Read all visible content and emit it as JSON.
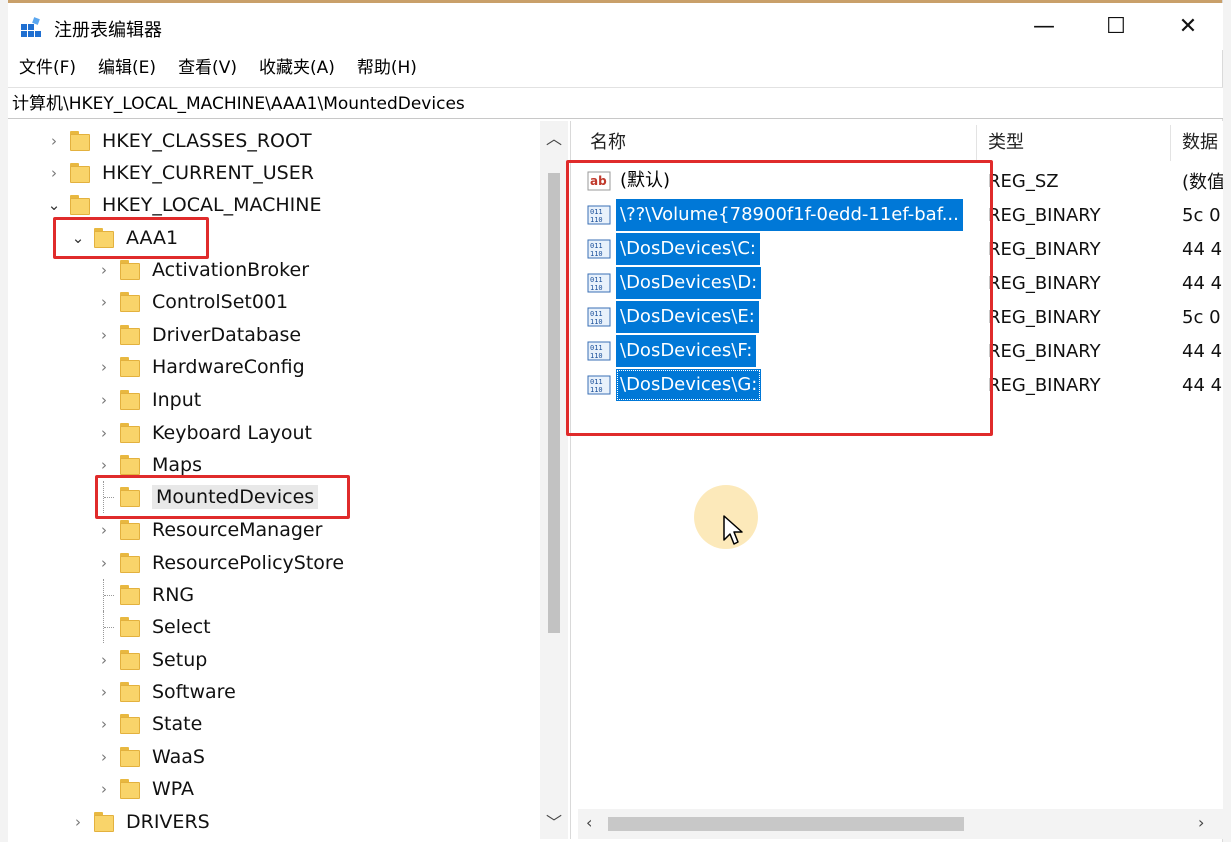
{
  "window": {
    "title": "注册表编辑器",
    "controls": {
      "minimize": "—",
      "maximize": "☐",
      "close": "✕"
    }
  },
  "menu": [
    "文件(F)",
    "编辑(E)",
    "查看(V)",
    "收藏夹(A)",
    "帮助(H)"
  ],
  "address": "计算机\\HKEY_LOCAL_MACHINE\\AAA1\\MountedDevices",
  "tree": {
    "roots": [
      "HKEY_CLASSES_ROOT",
      "HKEY_CURRENT_USER",
      "HKEY_LOCAL_MACHINE"
    ],
    "aaa1": "AAA1",
    "children": [
      "ActivationBroker",
      "ControlSet001",
      "DriverDatabase",
      "HardwareConfig",
      "Input",
      "Keyboard Layout",
      "Maps",
      "MountedDevices",
      "ResourceManager",
      "ResourcePolicyStore",
      "RNG",
      "Select",
      "Setup",
      "Software",
      "State",
      "WaaS",
      "WPA"
    ],
    "drivers": "DRIVERS",
    "selected": "MountedDevices"
  },
  "values": {
    "headers": {
      "name": "名称",
      "type": "类型",
      "data": "数据"
    },
    "rows": [
      {
        "name": "(默认)",
        "type": "REG_SZ",
        "data": "(数值",
        "icon": "string-value-icon"
      },
      {
        "name": "\\??\\Volume{78900f1f-0edd-11ef-baf...",
        "type": "REG_BINARY",
        "data": "5c 0",
        "icon": "binary-value-icon"
      },
      {
        "name": "\\DosDevices\\C:",
        "type": "REG_BINARY",
        "data": "44 4",
        "icon": "binary-value-icon"
      },
      {
        "name": "\\DosDevices\\D:",
        "type": "REG_BINARY",
        "data": "44 4",
        "icon": "binary-value-icon"
      },
      {
        "name": "\\DosDevices\\E:",
        "type": "REG_BINARY",
        "data": "5c 0",
        "icon": "binary-value-icon"
      },
      {
        "name": "\\DosDevices\\F:",
        "type": "REG_BINARY",
        "data": "44 4",
        "icon": "binary-value-icon"
      },
      {
        "name": "\\DosDevices\\G:",
        "type": "REG_BINARY",
        "data": "44 4",
        "icon": "binary-value-icon"
      }
    ]
  },
  "colors": {
    "selection": "#0078d7",
    "annotation": "#e02b2b",
    "folder": "#f9d46a"
  }
}
